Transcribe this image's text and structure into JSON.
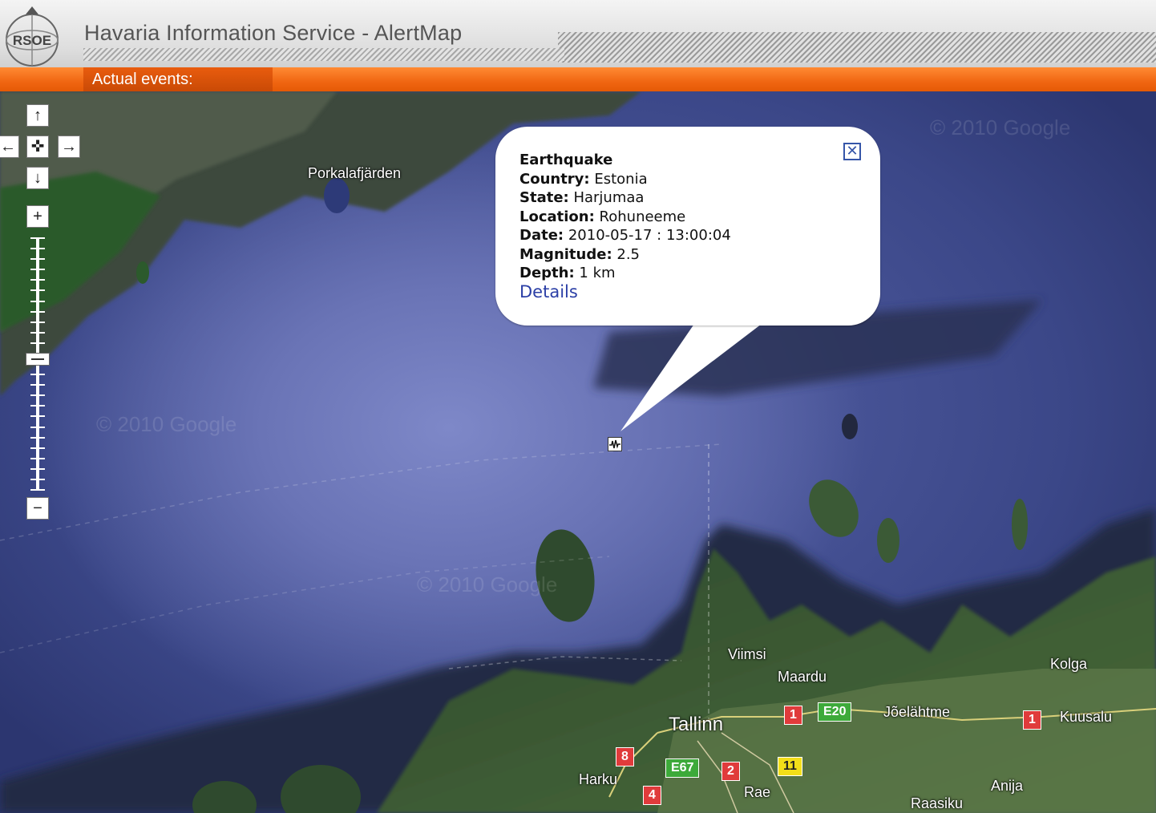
{
  "header": {
    "logo_text": "RSOE",
    "title": "Havaria Information Service - AlertMap",
    "events_tab_label": "Actual events:"
  },
  "nav": {
    "pan_up": "↑",
    "pan_left": "←",
    "pan_center": "✜",
    "pan_right": "→",
    "pan_down": "↓",
    "zoom_in": "+",
    "zoom_out": "−"
  },
  "map": {
    "places": {
      "porkalafjarden": "Porkalafjärden",
      "viimsi": "Viimsi",
      "maardu": "Maardu",
      "tallinn": "Tallinn",
      "joelahtme": "Jõelähtme",
      "kolga": "Kolga",
      "kuusalu": "Kuusalu",
      "harku": "Harku",
      "rae": "Rae",
      "anija": "Anija",
      "raasiku": "Raasiku"
    },
    "roads": {
      "r1a": "1",
      "e20": "E20",
      "r1b": "1",
      "r8": "8",
      "e67": "E67",
      "r2": "2",
      "r11": "11",
      "r4": "4"
    },
    "watermark": "© 2010 Google"
  },
  "popup": {
    "event_type": "Earthquake",
    "country_label": "Country:",
    "country": "Estonia",
    "state_label": "State:",
    "state": "Harjumaa",
    "location_label": "Location:",
    "location": "Rohuneeme",
    "date_label": "Date:",
    "date": "2010-05-17 : 13:00:04",
    "magnitude_label": "Magnitude:",
    "magnitude": "2.5",
    "depth_label": "Depth:",
    "depth": "1 km",
    "details_link": "Details",
    "close_glyph": "✕"
  },
  "zoom_level_fraction": 0.52
}
